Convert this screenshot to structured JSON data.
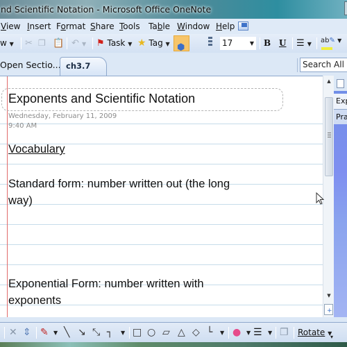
{
  "window": {
    "title": "nd Scientific Notation - Microsoft Office OneNote"
  },
  "menu": {
    "items": [
      {
        "label": "View",
        "accel": "V",
        "rest": "iew"
      },
      {
        "label": "Insert",
        "accel": "I",
        "rest": "nsert"
      },
      {
        "label": "Format",
        "pre": "F",
        "accel": "o",
        "rest": "rmat"
      },
      {
        "label": "Share",
        "accel": "S",
        "rest": "hare"
      },
      {
        "label": "Tools",
        "accel": "T",
        "rest": "ools"
      },
      {
        "label": "Table",
        "pre": "Ta",
        "accel": "b",
        "rest": "le"
      },
      {
        "label": "Window",
        "accel": "W",
        "rest": "indow"
      },
      {
        "label": "Help",
        "accel": "H",
        "rest": "elp"
      }
    ]
  },
  "toolbar": {
    "view_partial": "w",
    "task_label": "Task",
    "tag_label": "Tag",
    "font_size": "17",
    "bold_label": "B",
    "underline_label": "U",
    "highlight_label": "ab"
  },
  "tabs": {
    "open_sections_label": "Open Sectio...",
    "active_section": "ch3.7",
    "search_placeholder": "Search All No"
  },
  "page": {
    "title": "Exponents and Scientific Notation",
    "date": "Wednesday, February 11, 2009",
    "time": "9:40 AM",
    "notes": [
      {
        "text": "Vocabulary",
        "underline": true
      },
      {
        "text": "Standard form: number written out (the long"
      },
      {
        "text": "way)"
      },
      {
        "text": "Exponential Form: number written with"
      },
      {
        "text": "exponents"
      }
    ]
  },
  "page_pane": {
    "pages": [
      "Exp",
      "Pra"
    ]
  },
  "drawing_toolbar": {
    "rotate_label": "Rotate"
  },
  "colors": {
    "accent": "#dce8f6",
    "margin_line": "#e06b6b",
    "rule_line": "#c6dcea",
    "highlight_button": "#f7c56a"
  }
}
